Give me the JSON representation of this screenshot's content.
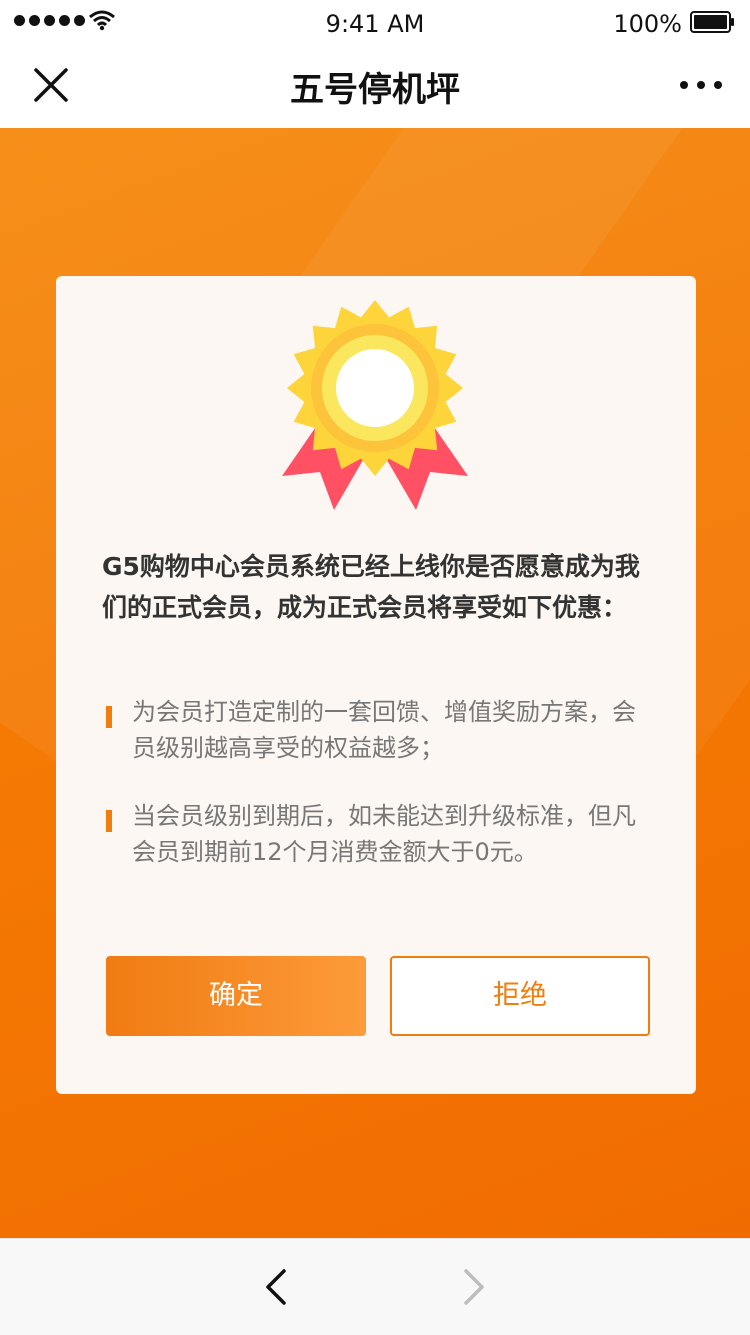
{
  "status_bar": {
    "time": "9:41 AM",
    "battery_percent": "100%",
    "battery_level": 1.0,
    "signal_icon": "signal-dots-icon",
    "wifi_icon": "wifi-icon"
  },
  "nav": {
    "title": "五号停机坪",
    "close_icon": "close-icon",
    "more_icon": "more-icon"
  },
  "card": {
    "badge_icon": "medal-icon",
    "intro": "G5购物中心会员系统已经上线你是否愿意成为我们的正式会员，成为正式会员将享受如下优惠：",
    "benefits": [
      "为会员打造定制的一套回馈、增值奖励方案，会员级别越高享受的权益越多；",
      "当会员级别到期后，如未能达到升级标准，但凡会员到期前12个月消费金额大于0元。"
    ],
    "confirm_label": "确定",
    "refuse_label": "拒绝"
  },
  "toolbar": {
    "back_icon": "chevron-left-icon",
    "forward_icon": "chevron-right-icon"
  },
  "colors": {
    "accent": "#f07d0d",
    "background_orange": "#f47a04",
    "card_background": "#fcf7f2"
  }
}
